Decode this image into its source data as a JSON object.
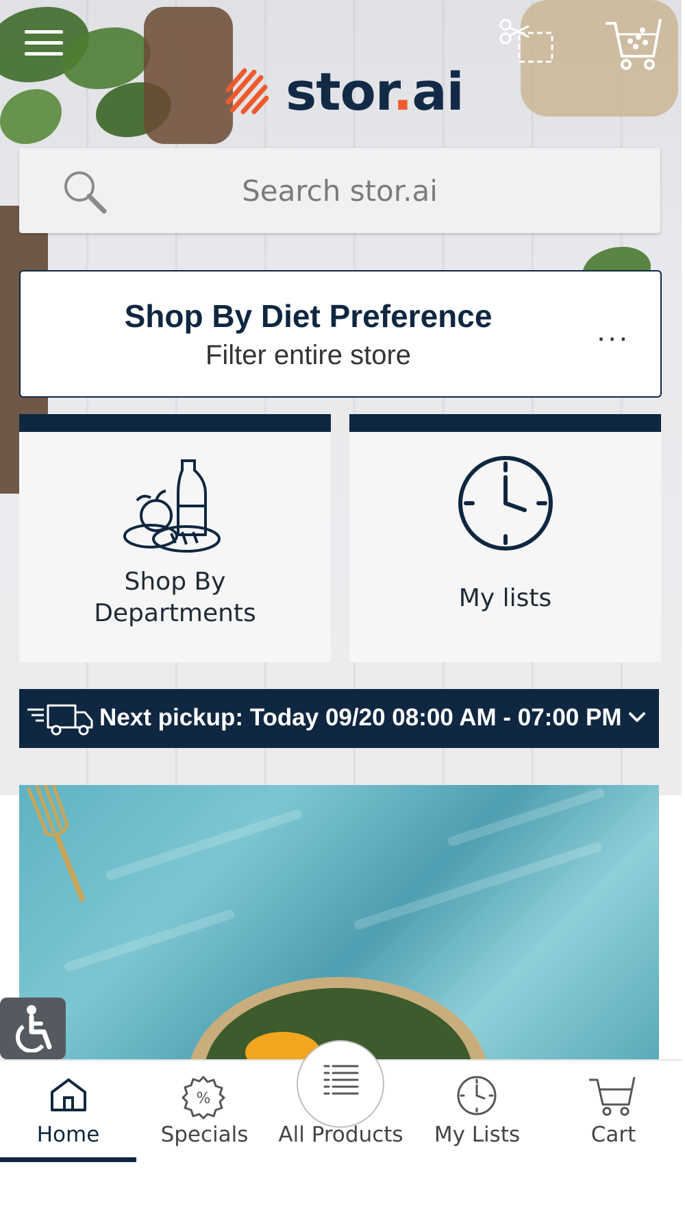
{
  "header": {
    "logo_text_main": "stor",
    "logo_text_dot": ".",
    "logo_text_tail": "ai",
    "icons": [
      "menu-icon",
      "coupon-scissors-icon",
      "cart-icon"
    ]
  },
  "search": {
    "placeholder": "Search stor.ai",
    "icon": "search-icon"
  },
  "diet": {
    "title": "Shop By Diet Preference",
    "subtitle": "Filter entire store",
    "more": "..."
  },
  "tiles": [
    {
      "label_line1": "Shop By",
      "label_line2": "Departments",
      "icon": "groceries-icon"
    },
    {
      "label": "My lists",
      "icon": "clock-icon"
    }
  ],
  "pickup": {
    "text": "Next pickup: Today 09/20 08:00 AM - 07:00 PM",
    "icon": "delivery-truck-icon"
  },
  "tabbar": {
    "items": [
      {
        "label": "Home",
        "icon": "home-icon",
        "active": true
      },
      {
        "label": "Specials",
        "icon": "percent-badge-icon",
        "active": false
      },
      {
        "label": "All Products",
        "icon": "list-icon",
        "active": false
      },
      {
        "label": "My Lists",
        "icon": "clock-icon",
        "active": false
      },
      {
        "label": "Cart",
        "icon": "cart-icon",
        "active": false
      }
    ]
  },
  "colors": {
    "brand_navy": "#0f2740",
    "brand_orange": "#ef5a2c"
  }
}
